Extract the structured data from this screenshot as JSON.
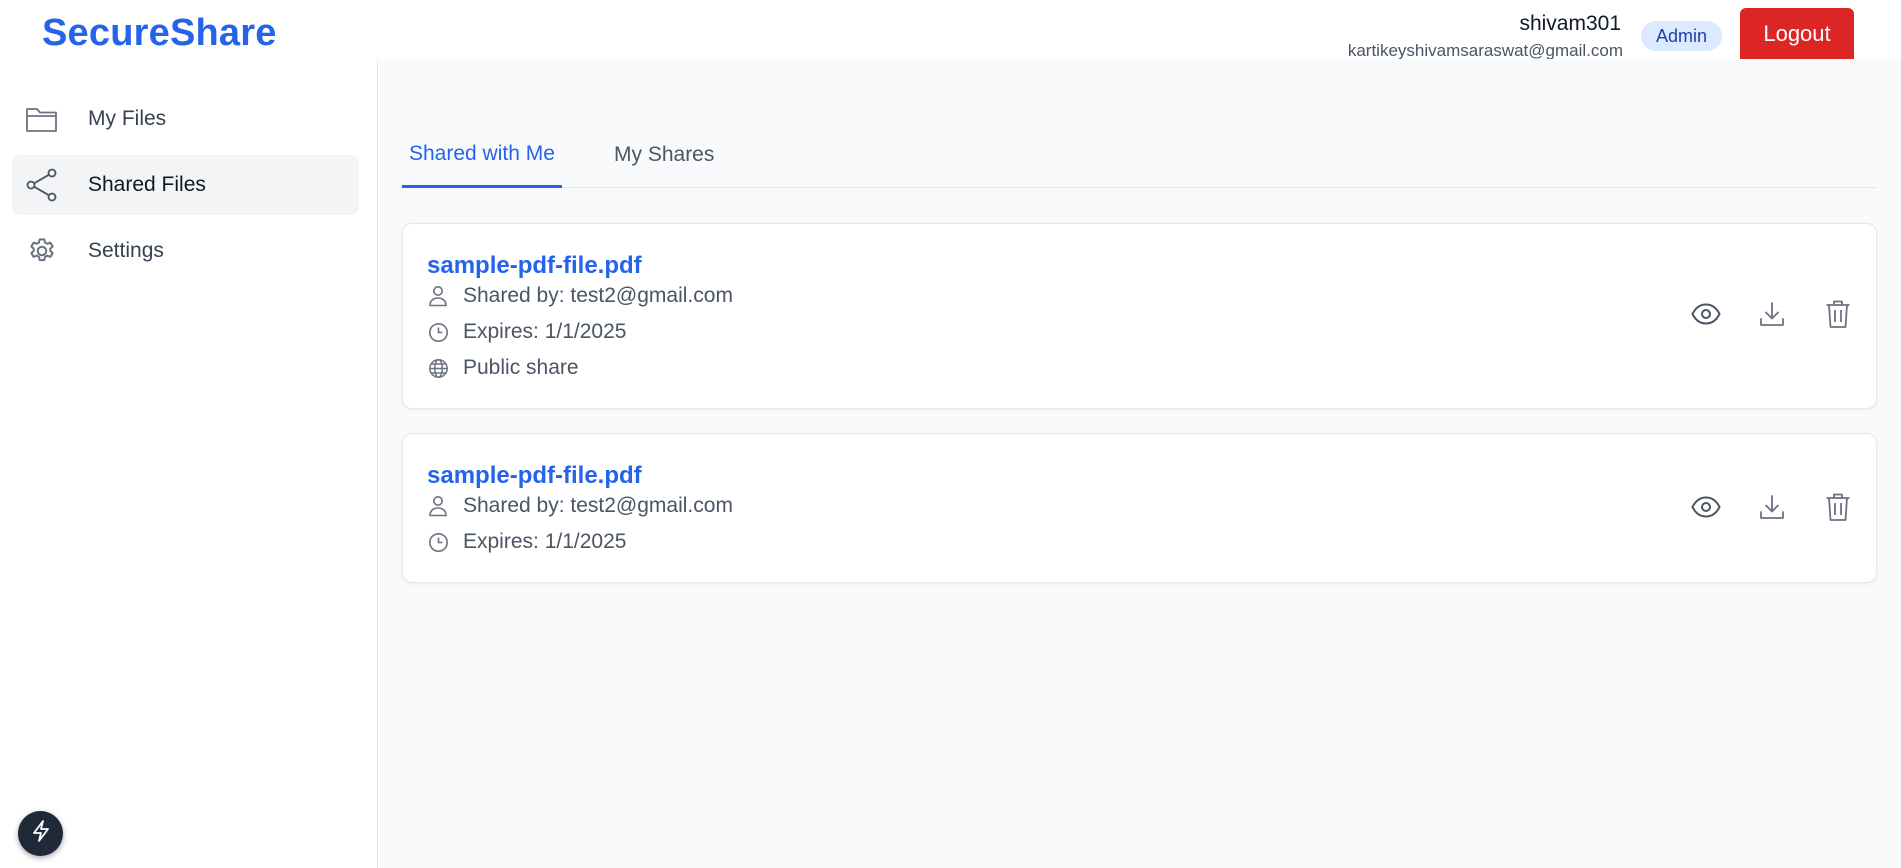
{
  "app": {
    "title": "SecureShare"
  },
  "user": {
    "name": "shivam301",
    "email": "kartikeyshivamsaraswat@gmail.com",
    "role": "Admin",
    "logout_label": "Logout"
  },
  "sidebar": {
    "items": [
      {
        "label": "My Files",
        "icon": "folder-icon",
        "active": false
      },
      {
        "label": "Shared Files",
        "icon": "share-icon",
        "active": true
      },
      {
        "label": "Settings",
        "icon": "gear-icon",
        "active": false
      }
    ]
  },
  "tabs": [
    {
      "label": "Shared with Me",
      "active": true
    },
    {
      "label": "My Shares",
      "active": false
    }
  ],
  "files": [
    {
      "name": "sample-pdf-file.pdf",
      "shared_by": "Shared by: test2@gmail.com",
      "expires": "Expires: 1/1/2025",
      "visibility": "Public share"
    },
    {
      "name": "sample-pdf-file.pdf",
      "shared_by": "Shared by: test2@gmail.com",
      "expires": "Expires: 1/1/2025"
    }
  ],
  "colors": {
    "brand": "#2563eb",
    "danger": "#dc2626",
    "badge_bg": "#dbeafe",
    "badge_text": "#1e40af",
    "main_bg": "#f9fafb"
  }
}
